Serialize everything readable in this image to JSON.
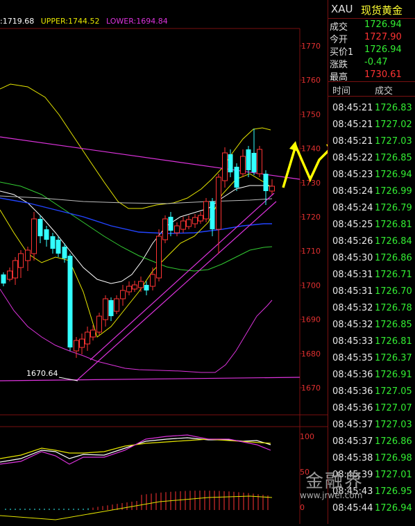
{
  "indicator": {
    "mid": ":1719.68",
    "upper": "UPPER:1744.52",
    "lower": "LOWER:1694.84"
  },
  "main_axis": [
    "1770",
    "1760",
    "1750",
    "1740",
    "1730",
    "1720",
    "1710",
    "1700",
    "1690",
    "1680",
    "1670"
  ],
  "low_marker": "1670.64",
  "sub_axis": [
    "100",
    "50",
    "0"
  ],
  "quote": {
    "symbol": "XAU",
    "name": "现货黄金",
    "rows": [
      {
        "label": "成交",
        "value": "1726.94",
        "color": "#33ee33"
      },
      {
        "label": "今开",
        "value": "1727.90",
        "color": "#ff3333"
      },
      {
        "label": "买价1",
        "value": "1726.94",
        "color": "#33ee33"
      },
      {
        "label": "涨跌",
        "value": "-0.47",
        "color": "#33ee33"
      },
      {
        "label": "最高",
        "value": "1730.61",
        "color": "#ff3333"
      }
    ]
  },
  "ticks": {
    "header_time": "时间",
    "header_price": "成交",
    "rows": [
      {
        "time": "08:45:21",
        "price": "1726.83"
      },
      {
        "time": "08:45:21",
        "price": "1727.02"
      },
      {
        "time": "08:45:21",
        "price": "1727.03"
      },
      {
        "time": "08:45:22",
        "price": "1726.85"
      },
      {
        "time": "08:45:23",
        "price": "1726.94"
      },
      {
        "time": "08:45:24",
        "price": "1726.99"
      },
      {
        "time": "08:45:24",
        "price": "1726.79"
      },
      {
        "time": "08:45:25",
        "price": "1726.81"
      },
      {
        "time": "08:45:26",
        "price": "1726.84"
      },
      {
        "time": "08:45:30",
        "price": "1726.86"
      },
      {
        "time": "08:45:31",
        "price": "1726.71"
      },
      {
        "time": "08:45:31",
        "price": "1726.70"
      },
      {
        "time": "08:45:32",
        "price": "1726.78"
      },
      {
        "time": "08:45:32",
        "price": "1726.85"
      },
      {
        "time": "08:45:33",
        "price": "1726.81"
      },
      {
        "time": "08:45:35",
        "price": "1726.37"
      },
      {
        "time": "08:45:36",
        "price": "1726.91"
      },
      {
        "time": "08:45:36",
        "price": "1727.05"
      },
      {
        "time": "08:45:36",
        "price": "1727.07"
      },
      {
        "time": "08:45:37",
        "price": "1727.03"
      },
      {
        "time": "08:45:37",
        "price": "1726.86"
      },
      {
        "time": "08:45:38",
        "price": "1726.98"
      },
      {
        "time": "08:45:39",
        "price": "1727.01"
      },
      {
        "time": "08:45:43",
        "price": "1726.95"
      },
      {
        "time": "08:45:44",
        "price": "1726.94"
      }
    ]
  },
  "watermark": {
    "text": "金融界",
    "url": "www.jrwei.com"
  },
  "colors": {
    "up": "#ff3333",
    "down": "#33ffff",
    "grid": "#7a1010",
    "annot": "#ffff00"
  }
}
